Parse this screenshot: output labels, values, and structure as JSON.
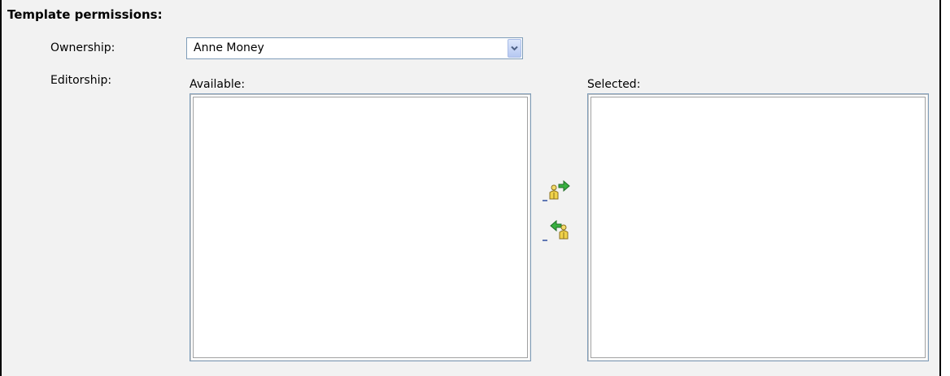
{
  "section": {
    "title": "Template permissions:"
  },
  "ownership": {
    "label": "Ownership:",
    "selected_value": "Anne Money"
  },
  "editorship": {
    "label": "Editorship:",
    "available_label": "Available:",
    "selected_label": "Selected:",
    "available_items": [],
    "selected_items": []
  },
  "icons": {
    "dropdown": "chevron-down-icon",
    "move_right": "add-user-arrow-right-icon",
    "move_left": "remove-user-arrow-left-icon"
  },
  "colors": {
    "panel_background": "#f2f2f2",
    "input_border": "#7f9db9",
    "arrow_green": "#2fa03a",
    "user_yellow": "#e8c840"
  }
}
